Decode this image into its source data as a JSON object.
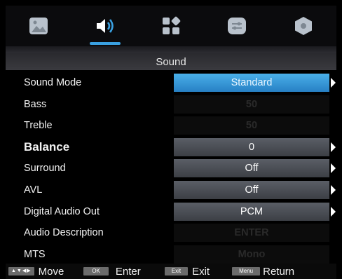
{
  "tabs": [
    {
      "icon": "picture-icon",
      "active": false
    },
    {
      "icon": "speaker-icon",
      "active": true
    },
    {
      "icon": "apps-icon",
      "active": false
    },
    {
      "icon": "settings-sliders-icon",
      "active": false
    },
    {
      "icon": "lock-hexagon-icon",
      "active": false
    }
  ],
  "menu": {
    "title": "Sound"
  },
  "rows": [
    {
      "label": "Sound Mode",
      "value": "Standard"
    },
    {
      "label": "Bass",
      "value": "50"
    },
    {
      "label": "Treble",
      "value": "50"
    },
    {
      "label": "Balance",
      "value": "0"
    },
    {
      "label": "Surround",
      "value": "Off"
    },
    {
      "label": "AVL",
      "value": "Off"
    },
    {
      "label": "Digital Audio Out",
      "value": "PCM"
    },
    {
      "label": "Audio Description",
      "value": "ENTER"
    },
    {
      "label": "MTS",
      "value": "Mono"
    }
  ],
  "footer": {
    "move_keys": "▲▼◀▶",
    "move_label": "Move",
    "ok_key": "OK",
    "ok_label": "Enter",
    "exit_key": "Exit",
    "exit_label": "Exit",
    "menu_key": "Menu",
    "menu_label": "Return"
  },
  "colors": {
    "accent": "#3aa0e0",
    "selected_row": "#2f8fd6",
    "value_box": "#4a4d54"
  }
}
